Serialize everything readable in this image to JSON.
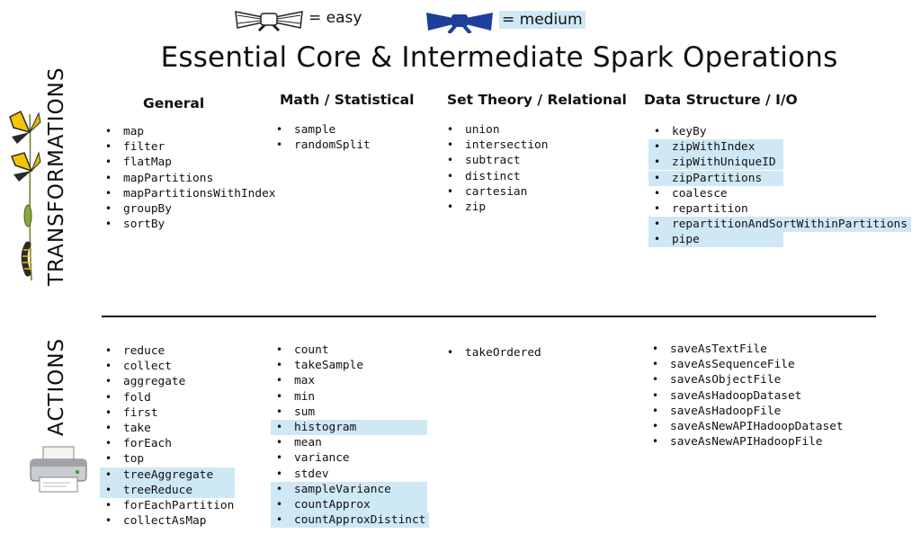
{
  "legend": {
    "easy_label": "= easy",
    "medium_label": "= medium",
    "colors": {
      "medium_highlight": "#cfe8f5",
      "medium_belt": "#1c3f9c",
      "easy_belt": "#ffffff"
    }
  },
  "title": "Essential Core & Intermediate Spark Operations",
  "columns": {
    "general": "General",
    "math": "Math / Statistical",
    "set": "Set Theory / Relational",
    "data": "Data Structure / I/O"
  },
  "transformations": {
    "label": "TRANSFORMATIONS",
    "general": [
      {
        "name": "map",
        "medium": false
      },
      {
        "name": "filter",
        "medium": false
      },
      {
        "name": "flatMap",
        "medium": false
      },
      {
        "name": "mapPartitions",
        "medium": false
      },
      {
        "name": "mapPartitionsWithIndex",
        "medium": false
      },
      {
        "name": "groupBy",
        "medium": false
      },
      {
        "name": "sortBy",
        "medium": false
      }
    ],
    "math": [
      {
        "name": "sample",
        "medium": false
      },
      {
        "name": "randomSplit",
        "medium": false
      }
    ],
    "set": [
      {
        "name": "union",
        "medium": false
      },
      {
        "name": "intersection",
        "medium": false
      },
      {
        "name": "subtract",
        "medium": false
      },
      {
        "name": "distinct",
        "medium": false
      },
      {
        "name": "cartesian",
        "medium": false
      },
      {
        "name": "zip",
        "medium": false
      }
    ],
    "data": [
      {
        "name": "keyBy",
        "medium": false
      },
      {
        "name": "zipWithIndex",
        "medium": true
      },
      {
        "name": "zipWithUniqueID",
        "medium": true
      },
      {
        "name": "zipPartitions",
        "medium": true
      },
      {
        "name": "coalesce",
        "medium": false
      },
      {
        "name": "repartition",
        "medium": false
      },
      {
        "name": "repartitionAndSortWithinPartitions",
        "medium": true
      },
      {
        "name": "pipe",
        "medium": true
      }
    ]
  },
  "actions": {
    "label": "ACTIONS",
    "general": [
      {
        "name": "reduce",
        "medium": false
      },
      {
        "name": "collect",
        "medium": false
      },
      {
        "name": "aggregate",
        "medium": false
      },
      {
        "name": "fold",
        "medium": false
      },
      {
        "name": "first",
        "medium": false
      },
      {
        "name": "take",
        "medium": false
      },
      {
        "name": "forEach",
        "medium": false
      },
      {
        "name": "top",
        "medium": false
      },
      {
        "name": "treeAggregate",
        "medium": true
      },
      {
        "name": "treeReduce",
        "medium": true
      },
      {
        "name": "forEachPartition",
        "medium": false
      },
      {
        "name": "collectAsMap",
        "medium": false
      }
    ],
    "math": [
      {
        "name": "count",
        "medium": false
      },
      {
        "name": "takeSample",
        "medium": false
      },
      {
        "name": "max",
        "medium": false
      },
      {
        "name": "min",
        "medium": false
      },
      {
        "name": "sum",
        "medium": false
      },
      {
        "name": "histogram",
        "medium": true
      },
      {
        "name": "mean",
        "medium": false
      },
      {
        "name": "variance",
        "medium": false
      },
      {
        "name": "stdev",
        "medium": false
      },
      {
        "name": "sampleVariance",
        "medium": true
      },
      {
        "name": "countApprox",
        "medium": true
      },
      {
        "name": "countApproxDistinct",
        "medium": true
      }
    ],
    "set": [
      {
        "name": "takeOrdered",
        "medium": false
      }
    ],
    "data": [
      {
        "name": "saveAsTextFile",
        "medium": false
      },
      {
        "name": "saveAsSequenceFile",
        "medium": false
      },
      {
        "name": "saveAsObjectFile",
        "medium": false
      },
      {
        "name": "saveAsHadoopDataset",
        "medium": false
      },
      {
        "name": "saveAsHadoopFile",
        "medium": false
      },
      {
        "name": "saveAsNewAPIHadoopDataset",
        "medium": false
      },
      {
        "name": "saveAsNewAPIHadoopFile",
        "medium": false
      }
    ]
  }
}
